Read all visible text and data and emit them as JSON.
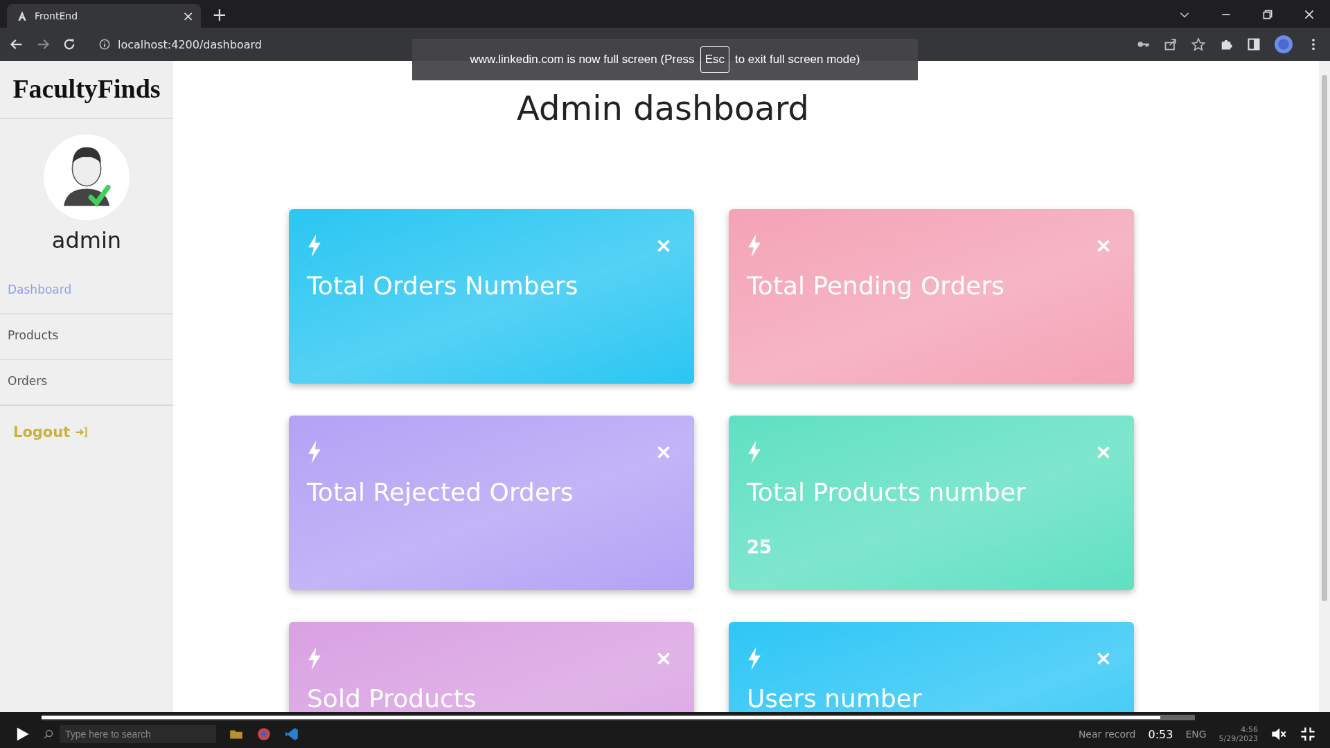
{
  "browser": {
    "tab": {
      "title": "FrontEnd",
      "close": "×"
    },
    "new_tab": "+",
    "address": "localhost:4200/dashboard"
  },
  "fullscreen_notice": {
    "before": "www.linkedin.com is now full screen (Press",
    "key": "Esc",
    "after": "to exit full screen mode)"
  },
  "sidebar": {
    "logo": "FacultyFinds",
    "user": "admin",
    "items": [
      {
        "label": "Dashboard",
        "selected": true
      },
      {
        "label": "Products",
        "selected": false
      },
      {
        "label": "Orders",
        "selected": false
      }
    ],
    "logout": "Logout"
  },
  "page": {
    "title": "Admin dashboard"
  },
  "cards": [
    {
      "title": "Total Orders Numbers",
      "color": "#2ac6f2"
    },
    {
      "title": "Total Pending Orders",
      "color": "#f4a3b6"
    },
    {
      "title": "Total Rejected Orders",
      "color": "#b3a2f5"
    },
    {
      "title": "Total Products number",
      "value": "25",
      "color": "#5fe0c2"
    },
    {
      "title": "Sold Products",
      "color": "#d9a1e2"
    },
    {
      "title": "Users number",
      "color": "#2ec6f6"
    }
  ],
  "player": {
    "level": 0.97,
    "time": "0:53"
  },
  "taskbar": {
    "search_placeholder": "Type here to search",
    "weather": "Near record",
    "language": "ENG",
    "clock": "4:56",
    "date": "5/29/2023"
  }
}
